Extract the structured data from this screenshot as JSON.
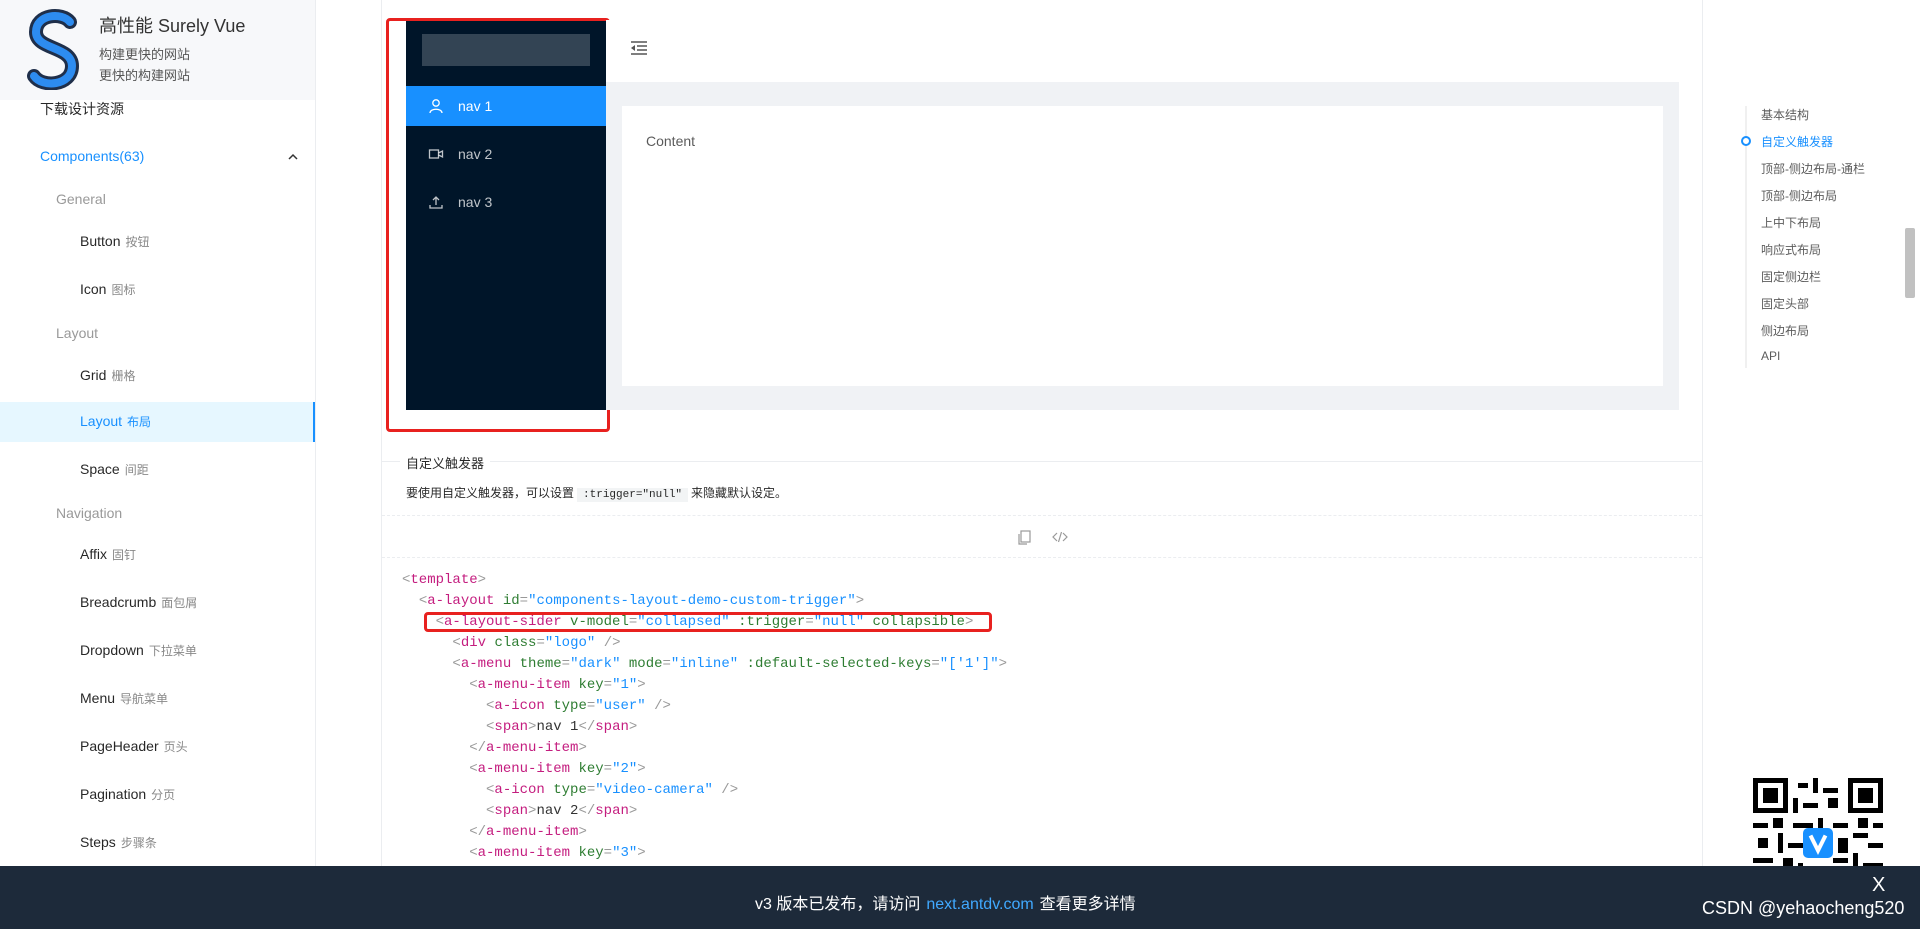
{
  "site": {
    "title": "高性能 Surely Vue",
    "subtitle1": "构建更快的网站",
    "subtitle2": "更快的构建网站"
  },
  "sidebar": {
    "download": "下载设计资源",
    "components": "Components(63)",
    "groups": {
      "general": "General",
      "layout": "Layout",
      "navigation": "Navigation"
    },
    "items": [
      {
        "label": "Button",
        "sub": "按钮"
      },
      {
        "label": "Icon",
        "sub": "图标"
      },
      {
        "label": "Grid",
        "sub": "栅格"
      },
      {
        "label": "Layout",
        "sub": "布局"
      },
      {
        "label": "Space",
        "sub": "间距"
      },
      {
        "label": "Affix",
        "sub": "固钉"
      },
      {
        "label": "Breadcrumb",
        "sub": "面包屑"
      },
      {
        "label": "Dropdown",
        "sub": "下拉菜单"
      },
      {
        "label": "Menu",
        "sub": "导航菜单"
      },
      {
        "label": "PageHeader",
        "sub": "页头"
      },
      {
        "label": "Pagination",
        "sub": "分页"
      },
      {
        "label": "Steps",
        "sub": "步骤条"
      }
    ]
  },
  "demo": {
    "menu": [
      "nav 1",
      "nav 2",
      "nav 3"
    ],
    "content": "Content",
    "title": "自定义触发器",
    "desc_before": "要使用自定义触发器，可以设置",
    "desc_code": ":trigger=\"null\"",
    "desc_after": "来隐藏默认设定。"
  },
  "toc": [
    "基本结构",
    "自定义触发器",
    "顶部-侧边布局-通栏",
    "顶部-侧边布局",
    "上中下布局",
    "响应式布局",
    "固定侧边栏",
    "固定头部",
    "侧边布局",
    "API"
  ],
  "banner": {
    "before": "v3 版本已发布，请访问",
    "link": "next.antdv.com",
    "after": "查看更多详情",
    "close": "X"
  },
  "watermark": "CSDN @yehaocheng520",
  "colors": {
    "primary": "#1890ff",
    "sider": "#001529",
    "highlight": "#e8211f"
  }
}
